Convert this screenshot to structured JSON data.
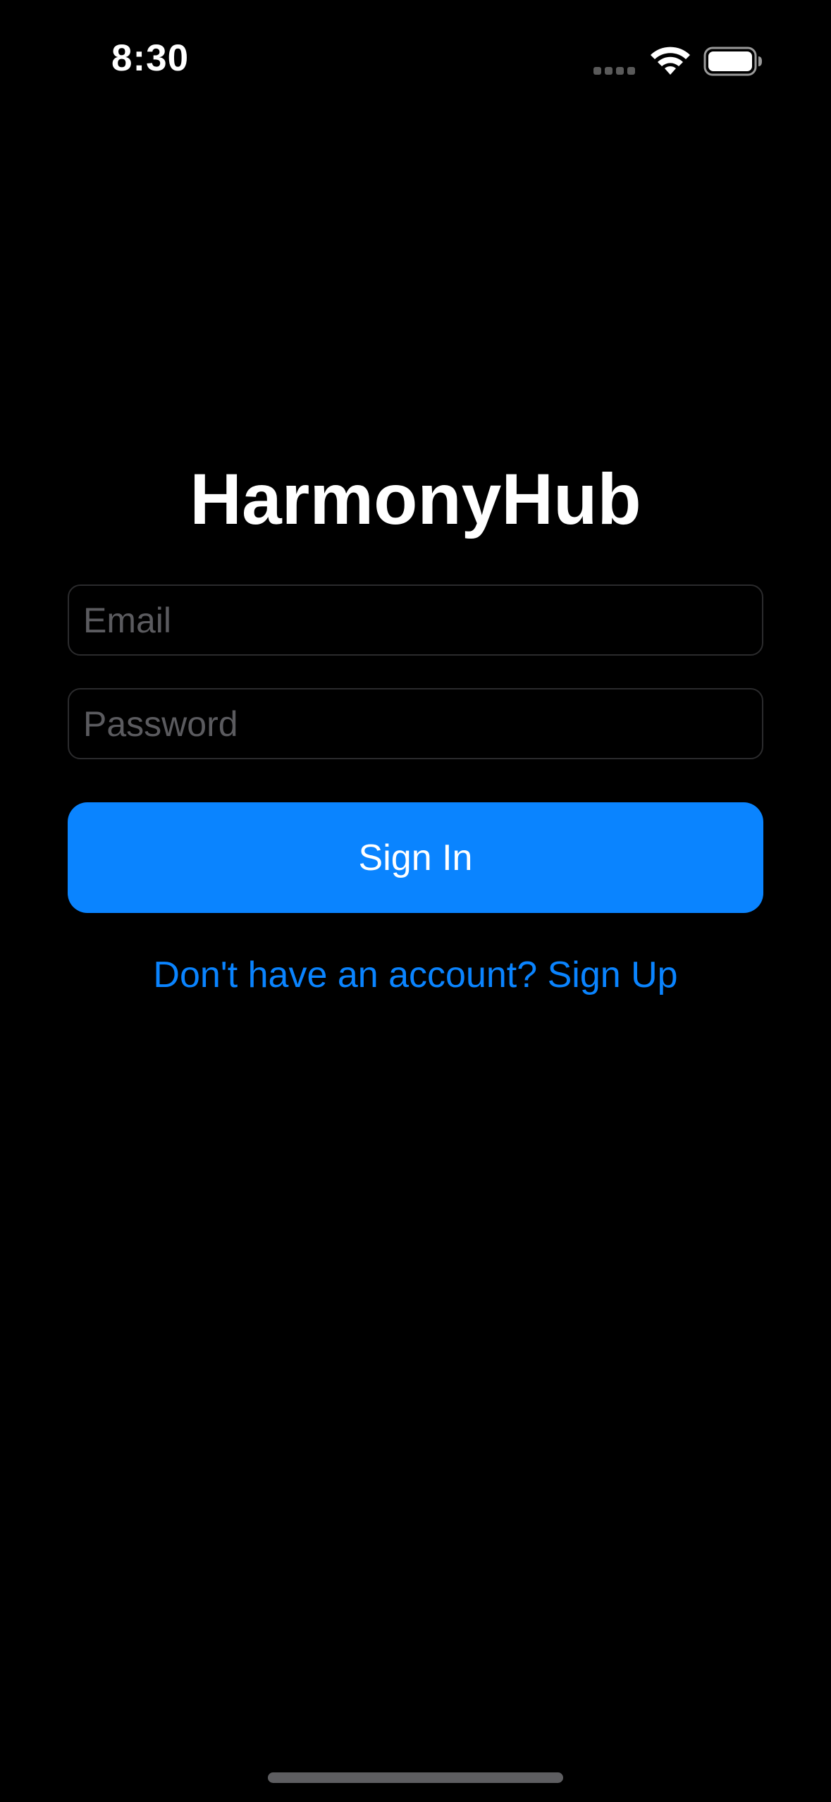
{
  "status_bar": {
    "time": "8:30",
    "icons": [
      "cellular-signal-icon",
      "wifi-icon",
      "battery-icon"
    ]
  },
  "app": {
    "title": "HarmonyHub"
  },
  "form": {
    "email": {
      "value": "",
      "placeholder": "Email"
    },
    "password": {
      "value": "",
      "placeholder": "Password"
    },
    "signin_label": "Sign In",
    "signup_link": "Don't have an account? Sign Up"
  },
  "colors": {
    "background": "#000000",
    "accent": "#0a84ff",
    "field_border": "#2b2b2d",
    "placeholder": "#5b5b5f",
    "text": "#ffffff"
  }
}
